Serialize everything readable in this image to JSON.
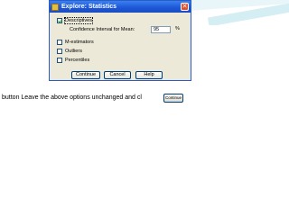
{
  "dialog": {
    "title": "Explore: Statistics",
    "options": {
      "descriptives": {
        "label": "Descriptives",
        "checked": true
      },
      "confidence_label": "Confidence Interval for Mean:",
      "confidence_value": "95",
      "confidence_unit": "%",
      "m_estimators": {
        "label": "M-estimators",
        "checked": false
      },
      "outliers": {
        "label": "Outliers",
        "checked": false
      },
      "percentiles": {
        "label": "Percentiles",
        "checked": false
      }
    },
    "buttons": {
      "continue": "Continue",
      "cancel": "Cancel",
      "help": "Help"
    }
  },
  "slide": {
    "instruction": "button Leave the above options unchanged and cl",
    "inline_button": "Continue"
  }
}
